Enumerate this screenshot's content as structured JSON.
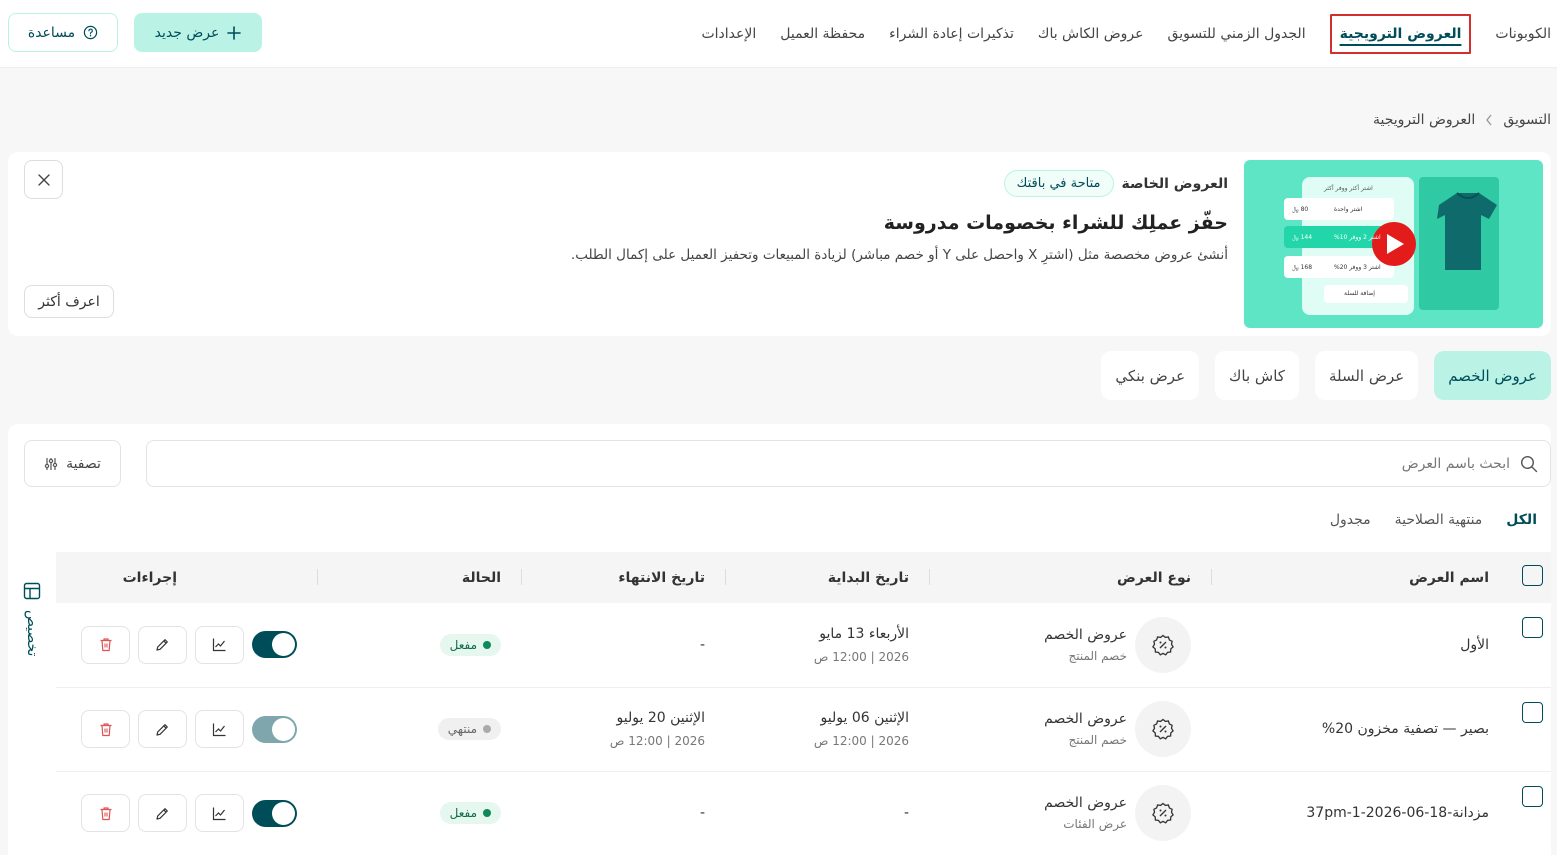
{
  "nav": {
    "tabs": [
      "الكوبونات",
      "العروض الترويجية",
      "الجدول الزمني للتسويق",
      "عروض الكاش باك",
      "تذكيرات إعادة الشراء",
      "محفظة العميل",
      "الإعدادات"
    ],
    "new_offer": "عرض جديد",
    "help": "مساعدة"
  },
  "breadcrumb": {
    "root": "التسويق",
    "current": "العروض الترويجية"
  },
  "banner": {
    "label": "العروض الخاصة",
    "pill": "متاحة في باقتك",
    "heading": "حفّز عملِك للشراء بخصومات مدروسة",
    "desc": "أنشئ عروض مخصصة مثل (اشترِ X واحصل على Y أو خصم مباشر) لزيادة المبيعات وتحفيز العميل على إكمال الطلب.",
    "learn_more": "اعرف أكثر",
    "img": {
      "head": "اشتر أكثر ووفر أكثر",
      "r1": "اشتر واحدة",
      "r1v": "80 ﷼",
      "r2": "اشتر 2 ووفر 10%",
      "r2v": "144 ﷼",
      "r3": "اشتر 3 ووفر 20%",
      "r3v": "168 ﷼",
      "cart": "إضافة للسلة"
    }
  },
  "segments": [
    "عروض الخصم",
    "عرض السلة",
    "كاش باك",
    "عرض بنكي"
  ],
  "search": {
    "placeholder": "ابحث باسم العرض"
  },
  "filter": "تصفية",
  "subtabs": [
    "الكل",
    "منتهية الصلاحية",
    "مجدول"
  ],
  "customize": "تخصيص",
  "table": {
    "headers": {
      "name": "اسم العرض",
      "type": "نوع العرض",
      "start": "تاريخ البداية",
      "end": "تاريخ الانتهاء",
      "status": "الحالة",
      "actions": "إجراءات"
    },
    "rows": [
      {
        "name": "الأول",
        "type": "عروض الخصم",
        "type_sub": "خصم المنتج",
        "start": "الأربعاء 13 مايو",
        "start_sub": "2026 | 12:00 ص",
        "end": "-",
        "end_sub": "",
        "status": "مفعل"
      },
      {
        "name": "بصير — تصفية مخزون 20%",
        "type": "عروض الخصم",
        "type_sub": "خصم المنتج",
        "start": "الإثنين 06 يوليو",
        "start_sub": "2026 | 12:00 ص",
        "end": "الإثنين 20 يوليو",
        "end_sub": "2026 | 12:00 ص",
        "status": "منتهي"
      },
      {
        "name": "مزدانة-18-06-2026-1-37pm",
        "type": "عروض الخصم",
        "type_sub": "عرض الفئات",
        "start": "-",
        "start_sub": "",
        "end": "-",
        "end_sub": "",
        "status": "مفعل"
      }
    ]
  },
  "colors": {
    "primary": "#004d5a",
    "accent": "#baf3e6",
    "highlight": "#d32f2f"
  }
}
